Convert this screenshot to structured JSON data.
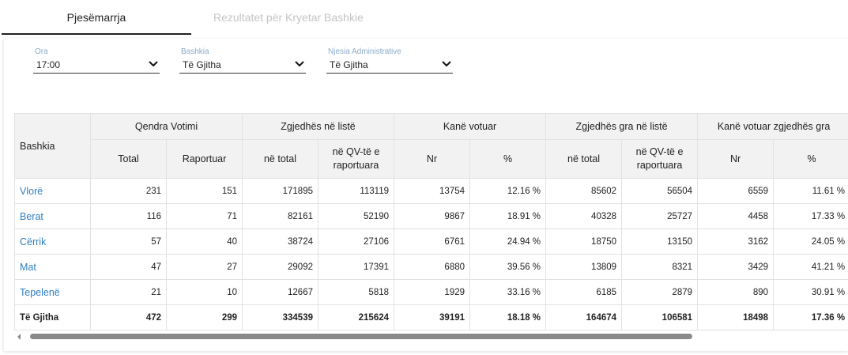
{
  "tabs": {
    "active": "Pjesëmarrja",
    "inactive": "Rezultatet për Kryetar Bashkie"
  },
  "filters": {
    "ora": {
      "label": "Ora",
      "value": "17:00"
    },
    "bashkia": {
      "label": "Bashkia",
      "value": "Të Gjitha"
    },
    "njesia": {
      "label": "Njesia Administrative",
      "value": "Të Gjitha"
    }
  },
  "table": {
    "group_headers": {
      "bashkia": "Bashkia",
      "qendra": "Qendra Votimi",
      "zgjedhes": "Zgjedhës në listë",
      "votuar": "Kanë votuar",
      "gra": "Zgjedhës gra në listë",
      "gra_votuar": "Kanë votuar zgjedhës gra"
    },
    "sub_headers": {
      "total": "Total",
      "raportuar": "Raportuar",
      "ne_total": "në total",
      "qv_line1": "në QV-të e",
      "qv_line2": "raportuara",
      "nr": "Nr",
      "pct": "%",
      "gra_ne_total": "në total",
      "gra_qv_line1": "në QV-të e",
      "gra_qv_line2": "raportuara",
      "gra_nr": "Nr",
      "gra_pct": "%"
    },
    "rows": [
      {
        "name": "Vlorë",
        "total": "231",
        "raportuar": "151",
        "ne_total": "171895",
        "qv": "113119",
        "nr": "13754",
        "pct": "12.16 %",
        "gra_total": "85602",
        "gra_qv": "56504",
        "gra_nr": "6559",
        "gra_pct": "11.61 %"
      },
      {
        "name": "Berat",
        "total": "116",
        "raportuar": "71",
        "ne_total": "82161",
        "qv": "52190",
        "nr": "9867",
        "pct": "18.91 %",
        "gra_total": "40328",
        "gra_qv": "25727",
        "gra_nr": "4458",
        "gra_pct": "17.33 %"
      },
      {
        "name": "Cërrik",
        "total": "57",
        "raportuar": "40",
        "ne_total": "38724",
        "qv": "27106",
        "nr": "6761",
        "pct": "24.94 %",
        "gra_total": "18750",
        "gra_qv": "13150",
        "gra_nr": "3162",
        "gra_pct": "24.05 %"
      },
      {
        "name": "Mat",
        "total": "47",
        "raportuar": "27",
        "ne_total": "29092",
        "qv": "17391",
        "nr": "6880",
        "pct": "39.56 %",
        "gra_total": "13809",
        "gra_qv": "8321",
        "gra_nr": "3429",
        "gra_pct": "41.21 %"
      },
      {
        "name": "Tepelenë",
        "total": "21",
        "raportuar": "10",
        "ne_total": "12667",
        "qv": "5818",
        "nr": "1929",
        "pct": "33.16 %",
        "gra_total": "6185",
        "gra_qv": "2879",
        "gra_nr": "890",
        "gra_pct": "30.91 %"
      }
    ],
    "totals": {
      "name": "Të Gjitha",
      "total": "472",
      "raportuar": "299",
      "ne_total": "334539",
      "qv": "215624",
      "nr": "39191",
      "pct": "18.18 %",
      "gra_total": "164674",
      "gra_qv": "106581",
      "gra_nr": "18498",
      "gra_pct": "17.36 %"
    }
  },
  "icons": {
    "dropdown": "chevron-down-icon",
    "scroll_left": "caret-left-icon"
  },
  "colors": {
    "link": "#2f7fc1",
    "header_bg": "#f2f2f2",
    "filter_label": "#8aaac8",
    "tab_inactive": "#c4c4c4"
  }
}
